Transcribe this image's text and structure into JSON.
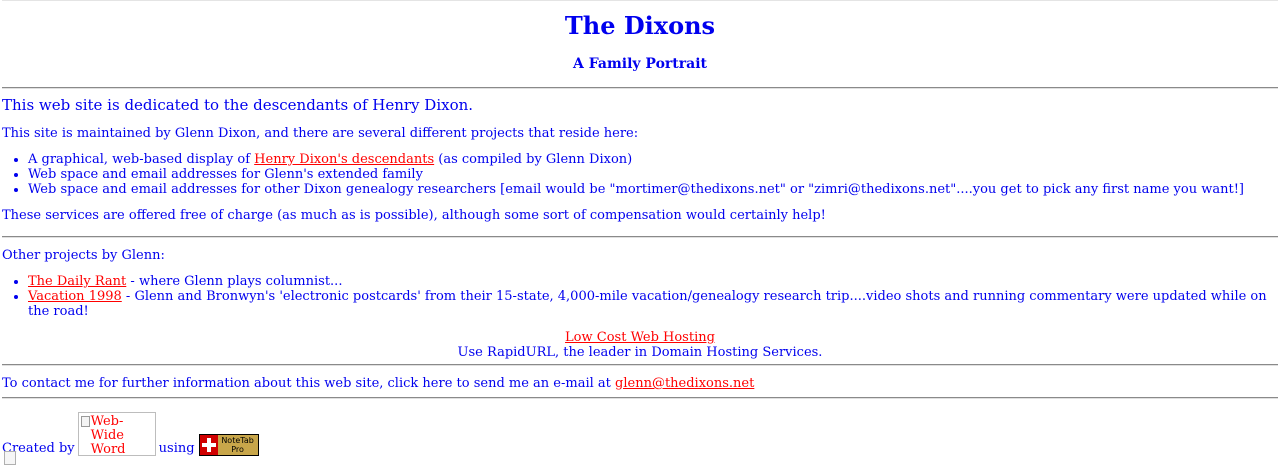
{
  "header": {
    "title": "The Dixons",
    "subtitle": "A Family Portrait"
  },
  "intro": "This web site is dedicated to the descendants of Henry Dixon.",
  "maintained": "This site is maintained by Glenn Dixon, and there are several different projects that reside here:",
  "projects": [
    {
      "prefix": "A graphical, web-based display of ",
      "link": "Henry Dixon's descendants",
      "suffix": " (as compiled by Glenn Dixon)"
    },
    {
      "text": "Web space and email addresses for Glenn's extended family"
    },
    {
      "text": "Web space and email addresses for other Dixon genealogy researchers [email would be \"mortimer@thedixons.net\" or \"zimri@thedixons.net\"....you get to pick any first name you want!]"
    }
  ],
  "free_note": "These services are offered free of charge (as much as is possible), although some sort of compensation would certainly help!",
  "other_heading": "Other projects by Glenn:",
  "other_projects": [
    {
      "link": "The Daily Rant",
      "suffix": " - where Glenn plays columnist..."
    },
    {
      "link": "Vacation 1998",
      "suffix": " - Glenn and Bronwyn's 'electronic postcards' from their 15-state, 4,000-mile vacation/genealogy research trip....video shots and running commentary were updated while on the road!"
    }
  ],
  "hosting": {
    "link": "Low Cost Web Hosting",
    "tagline": "Use RapidURL, the leader in Domain Hosting Services."
  },
  "contact": {
    "text": "To contact me for further information about this web site, click here to send me an e-mail at ",
    "email": "glenn@thedixons.net"
  },
  "footer": {
    "created_by": "Created by",
    "webwide_alt": "Web-Wide Word",
    "using": "using",
    "notetab_label": "NoteTab Pro"
  }
}
